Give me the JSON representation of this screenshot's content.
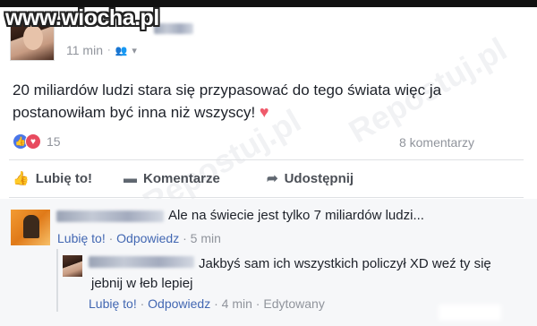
{
  "watermark": "www.wiocha.pl",
  "post": {
    "time": "11 min",
    "audience_icon": "friends-icon",
    "text": "20 miliardów ludzi stara się przypasować do tego świata więc ja postanowiłam być inna niż wszyscy!",
    "reaction_count": "15",
    "comment_count": "8 komentarzy"
  },
  "actions": {
    "like": "Lubię to!",
    "comment": "Komentarze",
    "share": "Udostępnij"
  },
  "comments": [
    {
      "text": "Ale na świecie jest tylko 7 miliardów ludzi...",
      "like": "Lubię to!",
      "reply": "Odpowiedz",
      "time": "5 min"
    },
    {
      "text_line1": "Jakbyś sam ich wszystkich policzył XD weź ty się",
      "text_line2": "jebnij w łeb lepiej",
      "like": "Lubię to!",
      "reply": "Odpowiedz",
      "time": "4 min",
      "edited": "Edytowany"
    }
  ],
  "colors": {
    "link": "#4267b2",
    "meta": "#90949c",
    "like_reaction": "#4a76e8",
    "love_reaction": "#e84a5f"
  }
}
